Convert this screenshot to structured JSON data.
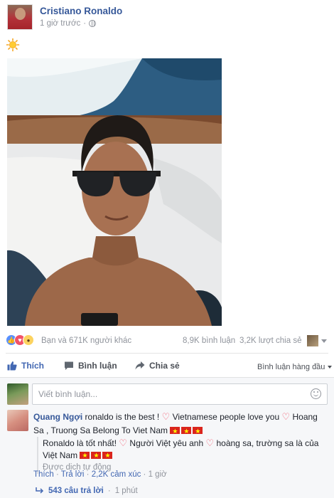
{
  "post": {
    "author": "Cristiano Ronaldo",
    "time": "1 giờ trước",
    "privacy_icon": "globe-icon",
    "emoji": "sun-icon"
  },
  "stats": {
    "reaction_icons": [
      "like-reaction",
      "love-reaction",
      "wow-reaction"
    ],
    "reactions_text": "Bạn và 671K người khác",
    "comments_text": "8,9K bình luận",
    "shares_text": "3,2K lượt chia sẻ"
  },
  "actions": {
    "like": "Thích",
    "comment": "Bình luận",
    "share": "Chia sẻ",
    "sort": "Bình luận hàng đầu"
  },
  "composer": {
    "placeholder": "Viết bình luận..."
  },
  "comment": {
    "author": "Quang Ngợi",
    "text_1": " ronaldo is the best ! ",
    "text_2": " Vietnamese people love you ",
    "text_3": " Hoang Sa , Truong Sa Belong To Viet Nam ",
    "translation_1": "Ronaldo là tốt nhất! ",
    "translation_2": " Người Việt yêu anh ",
    "translation_3": " hoàng sa, trường sa là của Việt Nam ",
    "translation_note": "Được dịch tự động",
    "like": "Thích",
    "reply": "Trả lời",
    "reactions": "2,2K cảm xúc",
    "time": "1 giờ",
    "replies_count": "543 câu trả lời",
    "replies_time": "1 phút"
  },
  "colors": {
    "link": "#365899",
    "action_blue": "#4267b2",
    "muted": "#90949c",
    "heart": "#f25268",
    "flag_red": "#da251d",
    "flag_star": "#ffff00"
  }
}
